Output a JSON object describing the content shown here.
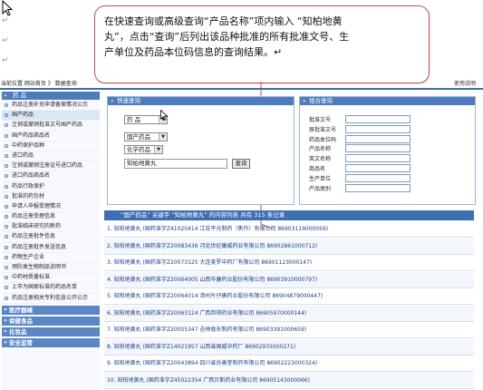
{
  "callout": {
    "line1": "在快速查询或高级查询“产品名称”项内输入 “知柏地黄",
    "line2": "丸”，点击“查询”后列出该品种批准的所有批准文号、生",
    "line3": "产单位及药品本位码信息的查询结果。↵"
  },
  "para_mark": "↵",
  "nav": {
    "breadcrumb": "当前位置 网站首页 》 数据查询",
    "help": "使用说明"
  },
  "sidebar": {
    "header": "药 品",
    "items": [
      "药品注册补充申请备案情况公示",
      "国产药品",
      "注销或撤销批准文号国产药品",
      "国产药品商品名",
      "中药保护品种",
      "进口药品",
      "注销或撤销注册证号进口药品",
      "进口药品商品名",
      "药品行政保护",
      "批准的药包材",
      "申请人申报受理情况",
      "药品注册受理信息",
      "批准临床研究的新药",
      "药品注册批件信息",
      "药品注册批件发送信息",
      "药物生产企业",
      "预防类生物制品说明书",
      "中药材质量标准",
      "上市为国家标准的药品名单",
      "药品注册相关专利信息公开公示"
    ],
    "active_index": 1,
    "categories": [
      "医疗器械",
      "保健食品",
      "化妆品",
      "安全监管"
    ]
  },
  "quick_search": {
    "title": "快速查询",
    "select1": "药 品",
    "select2": "国产药品",
    "select3": "化学药品",
    "input_value": "知柏地黄丸",
    "button": "查询"
  },
  "advanced_search": {
    "title": "组合查询",
    "fields": [
      "批准文号",
      "原批准文号",
      "药品本位码",
      "产品名称",
      "英文名称",
      "商品名",
      "生产单位",
      "产品类别"
    ]
  },
  "results": {
    "summary": "“国产药品” 关键字 “知柏地黄丸” 的内容列表 共有 315 条记录",
    "rows": [
      "1. 知柏地黄丸  (国药准字Z41020414 江苏平光制药（焦作）有限公司 86903119000056)",
      "2. 知柏地黄丸  (国药准字Z20083436 河北世纪康威药业有限公司 86902861000712)",
      "3. 知柏地黄丸  (国药准字Z20073125 大连美罗中药厂有限公司 86901123000147)",
      "4. 知柏地黄丸  (国药准字Z20064005 山西华康药业股份有限公司 86903910000797)",
      "5. 知柏地黄丸  (国药准字Z20064014 漳州片仔癀药业股份有限公司 86904879000447)",
      "6. 知柏地黄丸  (国药准字Z20063124 广西邦琪药业有限公司 86905970000144)",
      "7. 知柏地黄丸  (国药准字Z20055347 吉林敖东制药有限公司 86903391000659)",
      "8. 知柏地黄丸  (国药准字Z14021957 山西省国威中药厂 86902935000271)",
      "9. 知柏地黄丸  (国药准字Z20043894 四川省尚善堂制药有限公司 86902223000324)",
      "10. 知柏地黄丸  (国药准字Z45022354 广西贝斯药业有限公司 86905143000066)"
    ]
  },
  "colors": {
    "header_blue": "#4e7bbd",
    "callout_border": "#c0504d",
    "link_blue": "#1a3f8c"
  }
}
